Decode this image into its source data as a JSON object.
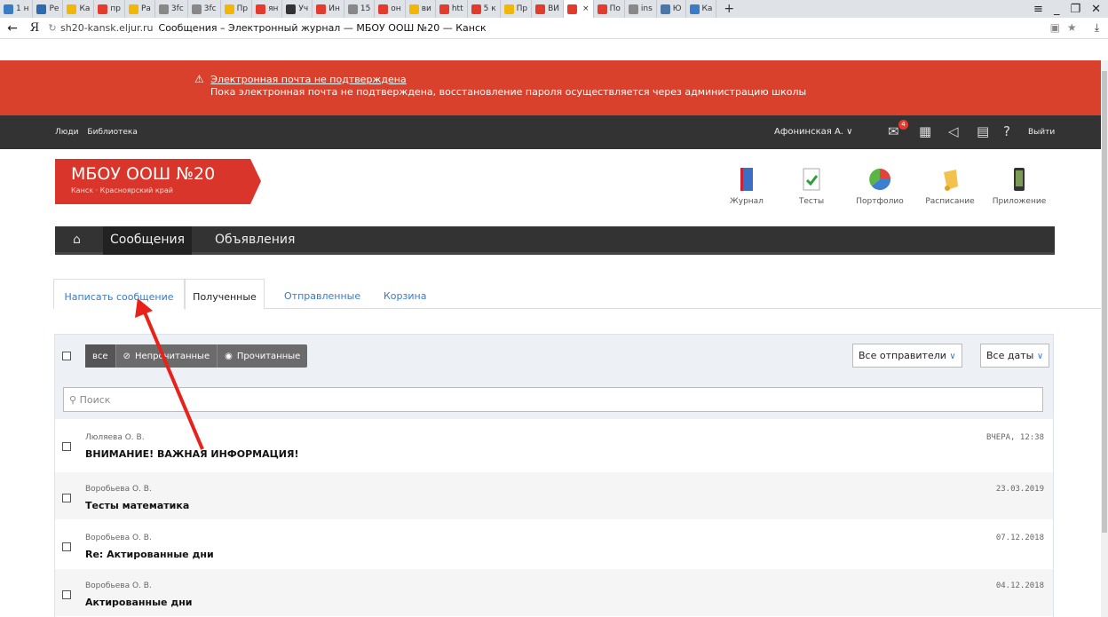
{
  "browser": {
    "tabs": [
      {
        "label": "1 н",
        "color": "#3a7bc8"
      },
      {
        "label": "Ре",
        "color": "#2b6cb0"
      },
      {
        "label": "Ка",
        "color": "#f2b705"
      },
      {
        "label": "пр",
        "color": "#e53b2c"
      },
      {
        "label": "Ра",
        "color": "#f2b705"
      },
      {
        "label": "3fc",
        "color": "#888888"
      },
      {
        "label": "3fc",
        "color": "#888888"
      },
      {
        "label": "Пр",
        "color": "#f2b705"
      },
      {
        "label": "ян",
        "color": "#e53b2c"
      },
      {
        "label": "Уч",
        "color": "#333333"
      },
      {
        "label": "Ин",
        "color": "#e53b2c"
      },
      {
        "label": "15",
        "color": "#888888"
      },
      {
        "label": "он",
        "color": "#e53b2c"
      },
      {
        "label": "ви",
        "color": "#f2b705"
      },
      {
        "label": "htt",
        "color": "#e53b2c"
      },
      {
        "label": "5 к",
        "color": "#e53b2c"
      },
      {
        "label": "Пр",
        "color": "#f2b705"
      },
      {
        "label": "ВИ",
        "color": "#e53b2c"
      },
      {
        "label": "",
        "color": "#e53b2c",
        "active": true
      },
      {
        "label": "По",
        "color": "#e53b2c"
      },
      {
        "label": "ins",
        "color": "#888888"
      },
      {
        "label": "Ю",
        "color": "#4a76a8"
      },
      {
        "label": "Ка",
        "color": "#3a7bc8"
      }
    ],
    "address": {
      "domain": "sh20-kansk.eljur.ru",
      "title": "Сообщения – Электронный журнал — МБОУ ООШ №20 — Канск"
    }
  },
  "warning": {
    "title": "Электронная почта не подтверждена",
    "text": "Пока электронная почта не подтверждена, восстановление пароля осуществляется через администрацию школы"
  },
  "topnav": {
    "links": [
      "Люди",
      "Библиотека"
    ],
    "user": "Афонинская А. ∨",
    "badge": "4",
    "logout": "Выйти"
  },
  "school": {
    "name": "МБОУ ООШ №20",
    "location": "Канск · Красноярский край",
    "color": "#d9352a"
  },
  "apps": [
    {
      "label": "Журнал",
      "icon": "journal-icon"
    },
    {
      "label": "Тесты",
      "icon": "tests-icon"
    },
    {
      "label": "Портфолио",
      "icon": "portfolio-icon"
    },
    {
      "label": "Расписание",
      "icon": "schedule-icon"
    },
    {
      "label": "Приложение",
      "icon": "phone-app-icon"
    }
  ],
  "secnav": {
    "items": [
      "Сообщения",
      "Объявления"
    ]
  },
  "tabs": [
    "Написать сообщение",
    "Полученные",
    "Отправленные",
    "Корзина"
  ],
  "filters": {
    "all": "все",
    "unread": "Непрочитанные",
    "read": "Прочитанные"
  },
  "selects": {
    "senders": "Все отправители",
    "dates": "Все даты"
  },
  "search": {
    "placeholder": "Поиск"
  },
  "messages": [
    {
      "sender": "Люляева О. В.",
      "subject": "ВНИМАНИЕ! ВАЖНАЯ ИНФОРМАЦИЯ!",
      "date": "ВЧЕРА, 12:38"
    },
    {
      "sender": "Воробьева О. В.",
      "subject": "Тесты математика",
      "date": "23.03.2019"
    },
    {
      "sender": "Воробьева О. В.",
      "subject": "Re: Актированные дни",
      "date": "07.12.2018"
    },
    {
      "sender": "Воробьева О. В.",
      "subject": "Актированные дни",
      "date": "04.12.2018"
    }
  ]
}
